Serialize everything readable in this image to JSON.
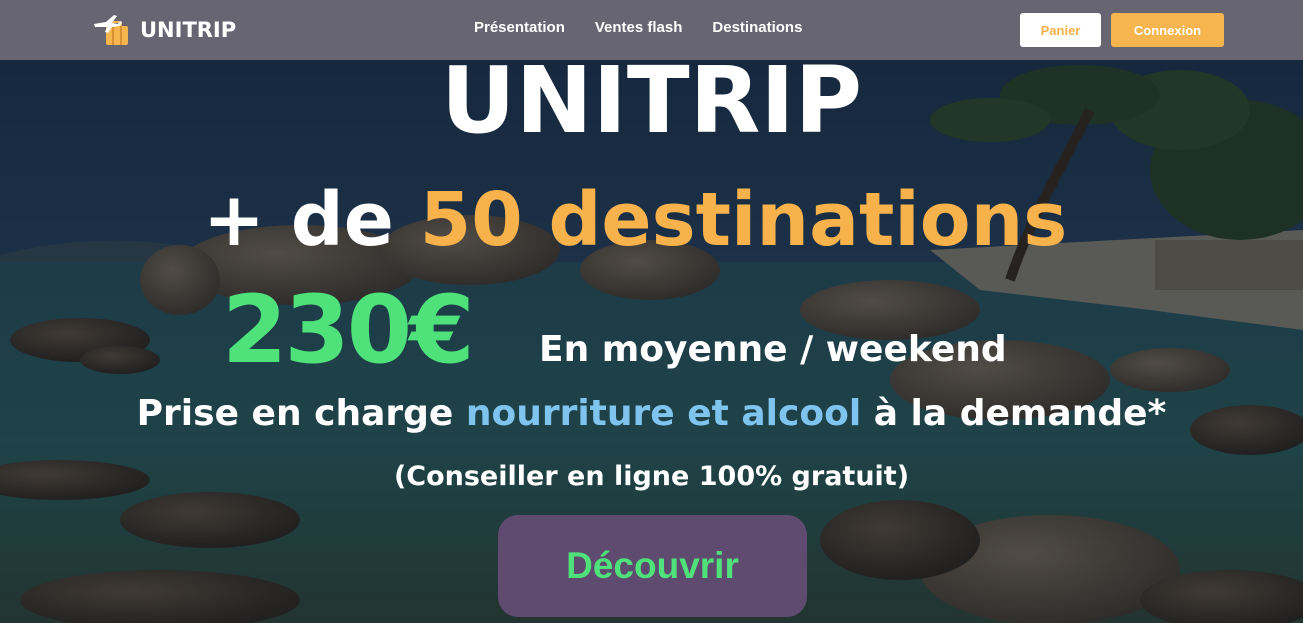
{
  "navbar": {
    "brand_name": "UNITRIP",
    "brand_icon": "plane-suitcase-icon",
    "links": [
      "Présentation",
      "Ventes flash",
      "Destinations"
    ],
    "cart_label": "Panier",
    "login_label": "Connexion"
  },
  "hero": {
    "title": "UNITRIP",
    "destinations_prefix": "+ de ",
    "destinations_highlight": "50 destinations",
    "price": "230€",
    "price_caption": "En moyenne / weekend",
    "service_prefix": "Prise en charge ",
    "service_highlight": "nourriture et alcool",
    "service_suffix": " à la demande*",
    "advisor_note": "(Conseiller en ligne 100% gratuit)",
    "cta_label": "Découvrir"
  },
  "colors": {
    "navbar_bg": "#6c6876",
    "accent_orange": "#f7b54f",
    "accent_green": "#4fe27a",
    "accent_blue": "#7fc4ef",
    "cta_bg": "#5e4b6f"
  }
}
